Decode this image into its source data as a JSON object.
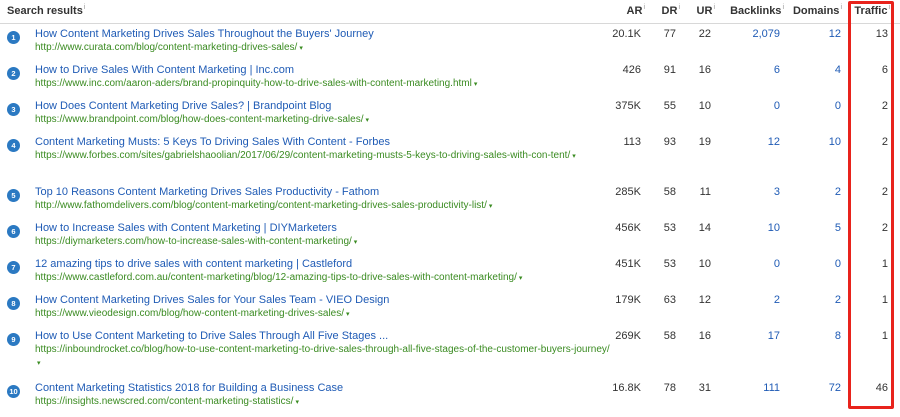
{
  "headers": {
    "search": "Search results",
    "ar": "AR",
    "dr": "DR",
    "ur": "UR",
    "backlinks": "Backlinks",
    "domains": "Domains",
    "traffic": "Traffic",
    "info_glyph": "i"
  },
  "caret": "▾",
  "rows": [
    {
      "num": "1",
      "title": "How Content Marketing Drives Sales Throughout the Buyers' Journey",
      "url": "http://www.curata.com/blog/content-marketing-drives-sales/",
      "ar": "20.1K",
      "dr": "77",
      "ur": "22",
      "backlinks": "2,079",
      "domains": "12",
      "traffic": "13"
    },
    {
      "num": "2",
      "title": "How to Drive Sales With Content Marketing | Inc.com",
      "url": "https://www.inc.com/aaron-aders/brand-propinquity-how-to-drive-sales-with-content-marketing.html",
      "ar": "426",
      "dr": "91",
      "ur": "16",
      "backlinks": "6",
      "domains": "4",
      "traffic": "6"
    },
    {
      "num": "3",
      "title": "How Does Content Marketing Drive Sales? | Brandpoint Blog",
      "url": "https://www.brandpoint.com/blog/how-does-content-marketing-drive-sales/",
      "ar": "375K",
      "dr": "55",
      "ur": "10",
      "backlinks": "0",
      "domains": "0",
      "traffic": "2"
    },
    {
      "num": "4",
      "title": "Content Marketing Musts: 5 Keys To Driving Sales With Content - Forbes",
      "url": "https://www.forbes.com/sites/gabrielshaoolian/2017/06/29/content-marketing-musts-5-keys-to-driving-sales-with-con-tent/",
      "ar": "113",
      "dr": "93",
      "ur": "19",
      "backlinks": "12",
      "domains": "10",
      "traffic": "2"
    },
    {
      "num": "5",
      "title": "Top 10 Reasons Content Marketing Drives Sales Productivity - Fathom",
      "url": "http://www.fathomdelivers.com/blog/content-marketing/content-marketing-drives-sales-productivity-list/",
      "ar": "285K",
      "dr": "58",
      "ur": "11",
      "backlinks": "3",
      "domains": "2",
      "traffic": "2"
    },
    {
      "num": "6",
      "title": "How to Increase Sales with Content Marketing | DIYMarketers",
      "url": "https://diymarketers.com/how-to-increase-sales-with-content-marketing/",
      "ar": "456K",
      "dr": "53",
      "ur": "14",
      "backlinks": "10",
      "domains": "5",
      "traffic": "2"
    },
    {
      "num": "7",
      "title": "12 amazing tips to drive sales with content marketing | Castleford",
      "url": "https://www.castleford.com.au/content-marketing/blog/12-amazing-tips-to-drive-sales-with-content-marketing/",
      "ar": "451K",
      "dr": "53",
      "ur": "10",
      "backlinks": "0",
      "domains": "0",
      "traffic": "1"
    },
    {
      "num": "8",
      "title": "How Content Marketing Drives Sales for Your Sales Team - VIEO Design",
      "url": "https://www.vieodesign.com/blog/how-content-marketing-drives-sales/",
      "ar": "179K",
      "dr": "63",
      "ur": "12",
      "backlinks": "2",
      "domains": "2",
      "traffic": "1"
    },
    {
      "num": "9",
      "title": "How to Use Content Marketing to Drive Sales Through All Five Stages ...",
      "url": "https://inboundrocket.co/blog/how-to-use-content-marketing-to-drive-sales-through-all-five-stages-of-the-customer-buyers-journey/",
      "ar": "269K",
      "dr": "58",
      "ur": "16",
      "backlinks": "17",
      "domains": "8",
      "traffic": "1"
    },
    {
      "num": "10",
      "title": "Content Marketing Statistics 2018 for Building a Business Case",
      "url": "https://insights.newscred.com/content-marketing-statistics/",
      "ar": "16.8K",
      "dr": "78",
      "ur": "31",
      "backlinks": "111",
      "domains": "72",
      "traffic": "46"
    }
  ]
}
